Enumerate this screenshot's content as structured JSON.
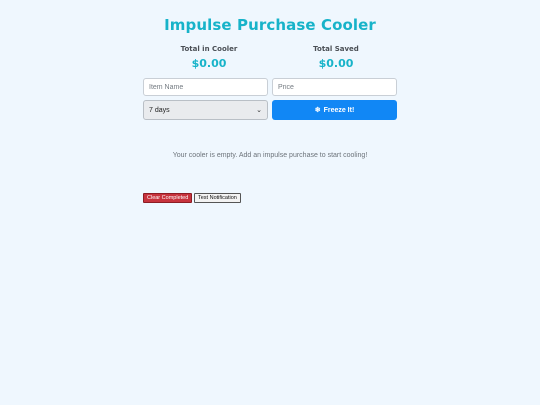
{
  "header": {
    "title": "Impulse Purchase Cooler"
  },
  "stats": {
    "total_label": "Total in Cooler",
    "total_value": "$0.00",
    "saved_label": "Total Saved",
    "saved_value": "$0.00"
  },
  "form": {
    "item_placeholder": "Item Name",
    "price_placeholder": "Price",
    "duration_selected": "7 days",
    "freeze_label": "Freeze It!",
    "freeze_icon": "snowflake-icon"
  },
  "empty_state": {
    "message": "Your cooler is empty. Add an impulse purchase to start cooling!"
  },
  "actions": {
    "clear_label": "Clear Completed",
    "test_label": "Test Notification"
  },
  "colors": {
    "background": "#eff7fe",
    "accent": "#17b3c9",
    "primary_button": "#1187f5",
    "danger_button": "#c7333d"
  }
}
